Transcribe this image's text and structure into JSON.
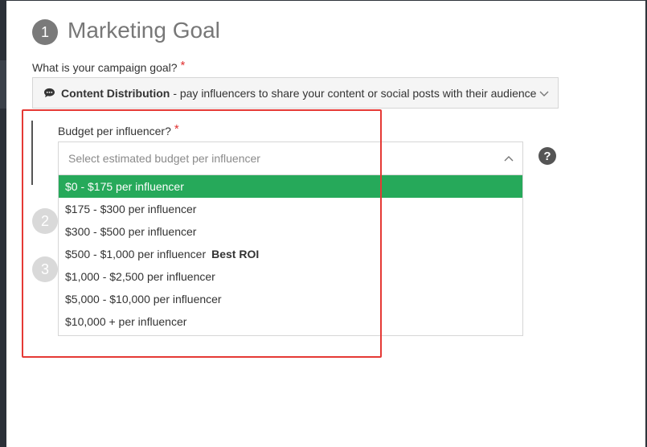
{
  "steps": [
    {
      "number": "1",
      "title": "Marketing Goal"
    },
    {
      "number": "2"
    },
    {
      "number": "3"
    }
  ],
  "goal": {
    "label": "What is your campaign goal?",
    "required_mark": "*",
    "selected_name": "Content Distribution",
    "selected_desc": "- pay influencers to share your content or social posts with their audience"
  },
  "budget": {
    "label": "Budget per influencer?",
    "required_mark": "*",
    "placeholder": "Select estimated budget per influencer",
    "help": "?",
    "options": [
      {
        "label": "$0 - $175 per influencer",
        "tag": "",
        "selected": true
      },
      {
        "label": "$175 - $300 per influencer",
        "tag": ""
      },
      {
        "label": "$300 - $500 per influencer",
        "tag": ""
      },
      {
        "label": "$500 - $1,000 per influencer",
        "tag": "Best ROI"
      },
      {
        "label": "$1,000 - $2,500 per influencer",
        "tag": ""
      },
      {
        "label": "$5,000 - $10,000 per influencer",
        "tag": ""
      },
      {
        "label": "$10,000 + per influencer",
        "tag": ""
      }
    ]
  },
  "colors": {
    "selected_option": "#26a95a",
    "required": "#e03131",
    "highlight_box": "#e53935"
  }
}
